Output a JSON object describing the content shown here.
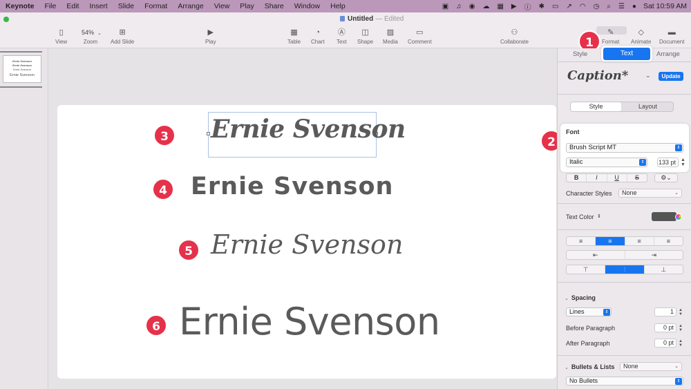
{
  "menubar": {
    "app": "Keynote",
    "items": [
      "File",
      "Edit",
      "Insert",
      "Slide",
      "Format",
      "Arrange",
      "View",
      "Play",
      "Share",
      "Window",
      "Help"
    ],
    "clock": "Sat 10:59 AM"
  },
  "document": {
    "title": "Untitled",
    "status": "— Edited"
  },
  "toolbar": {
    "view": "View",
    "zoom_value": "54%",
    "zoom": "Zoom",
    "add_slide": "Add Slide",
    "play": "Play",
    "table": "Table",
    "chart": "Chart",
    "text": "Text",
    "shape": "Shape",
    "media": "Media",
    "comment": "Comment",
    "collaborate": "Collaborate",
    "format": "Format",
    "animate": "Animate",
    "document": "Document"
  },
  "thumbnail": {
    "lines": [
      "Ernie Svenson",
      "Ernie Svenson",
      "Ernie Svenson",
      "Ernie Svenson"
    ]
  },
  "slide": {
    "lines": [
      "Ernie Svenson",
      "Ernie Svenson",
      "Ernie Svenson",
      "Ernie Svenson"
    ]
  },
  "markers": [
    "1",
    "2",
    "3",
    "4",
    "5",
    "6"
  ],
  "inspector": {
    "tabs": {
      "style": "Style",
      "text": "Text",
      "arrange": "Arrange"
    },
    "paragraph_style": "Caption*",
    "update": "Update",
    "subtabs": {
      "style": "Style",
      "layout": "Layout"
    },
    "font_label": "Font",
    "font_family": "Brush Script MT",
    "font_typeface": "Italic",
    "font_size": "133 pt",
    "bius": [
      "B",
      "I",
      "U",
      "S"
    ],
    "character_styles_label": "Character Styles",
    "character_styles_value": "None",
    "text_color_label": "Text Color",
    "align_buttons": [
      "≡",
      "≡",
      "≡",
      "≡"
    ],
    "indent_buttons": [
      "⇤",
      "⇥"
    ],
    "vertical_buttons": [
      "⊤",
      "⫶",
      "⊥"
    ],
    "spacing_label": "Spacing",
    "spacing_mode": "Lines",
    "spacing_value": "1",
    "before_paragraph_label": "Before Paragraph",
    "before_paragraph_value": "0 pt",
    "after_paragraph_label": "After Paragraph",
    "after_paragraph_value": "0 pt",
    "bullets_label": "Bullets & Lists",
    "bullets_value": "None",
    "bullets_select": "No Bullets"
  },
  "colors": {
    "accent": "#1875f0",
    "marker": "#e6314a",
    "menubar": "#bb97b9",
    "text_color": "#555555"
  }
}
